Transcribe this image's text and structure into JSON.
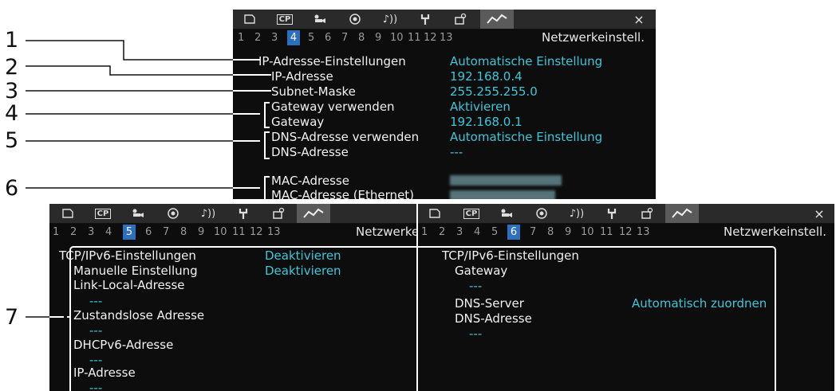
{
  "tabs": {
    "icons": [
      "media-icon",
      "cp-icon",
      "camera-icon",
      "recording-icon",
      "audio-icon",
      "wrench-icon",
      "custom-menu-icon",
      "network-icon"
    ],
    "cp_label": "CP",
    "close": "×"
  },
  "screen_top": {
    "pages": [
      "1",
      "2",
      "3",
      "4",
      "5",
      "6",
      "7",
      "8",
      "9",
      "10",
      "11",
      "12",
      "13"
    ],
    "active_page": "4",
    "title": "Netzwerkeinstell.",
    "rows": [
      {
        "label": "IP-Adresse-Einstellungen",
        "value": "Automatische Einstellung"
      },
      {
        "label": "IP-Adresse",
        "value": "192.168.0.4"
      },
      {
        "label": "Subnet-Maske",
        "value": "255.255.255.0"
      },
      {
        "label": "Gateway verwenden",
        "value": "Aktivieren"
      },
      {
        "label": "Gateway",
        "value": "192.168.0.1"
      },
      {
        "label": "DNS-Adresse verwenden",
        "value": "Automatische Einstellung"
      },
      {
        "label": "DNS-Adresse",
        "value": "---"
      },
      {
        "label": "MAC-Adresse",
        "value": ""
      },
      {
        "label": "MAC-Adresse (Ethernet)",
        "value": ""
      }
    ]
  },
  "screen_left": {
    "pages": [
      "1",
      "2",
      "3",
      "4",
      "5",
      "6",
      "7",
      "8",
      "9",
      "10",
      "11",
      "12",
      "13"
    ],
    "active_page": "5",
    "title": "Netzwerke",
    "rows": [
      {
        "label": "TCP/IPv6-Einstellungen",
        "value": "Deaktivieren"
      },
      {
        "label": "Manuelle Einstellung",
        "value": "Deaktivieren"
      },
      {
        "label": "Link-Local-Adresse",
        "value": "---"
      },
      {
        "label": "Zustandslose Adresse",
        "value": "---"
      },
      {
        "label": "DHCPv6-Adresse",
        "value": "---"
      },
      {
        "label": "IP-Adresse",
        "value": "---"
      }
    ]
  },
  "screen_right": {
    "pages": [
      "1",
      "2",
      "3",
      "4",
      "5",
      "6",
      "7",
      "8",
      "9",
      "10",
      "11",
      "12",
      "13"
    ],
    "active_page": "6",
    "title": "Netzwerkeinstell.",
    "rows": [
      {
        "label": "TCP/IPv6-Einstellungen",
        "value": ""
      },
      {
        "label": "Gateway",
        "value": "---"
      },
      {
        "label": "DNS-Server",
        "value": "Automatisch zuordnen"
      },
      {
        "label": "DNS-Adresse",
        "value": "---"
      }
    ]
  },
  "callouts": [
    "1",
    "2",
    "3",
    "4",
    "5",
    "6",
    "7"
  ],
  "colors": {
    "value": "#3fc6d8",
    "active_page": "#2d6fbd",
    "screen_bg": "#0d0d0d",
    "tabbar": "#2a2a2a"
  }
}
